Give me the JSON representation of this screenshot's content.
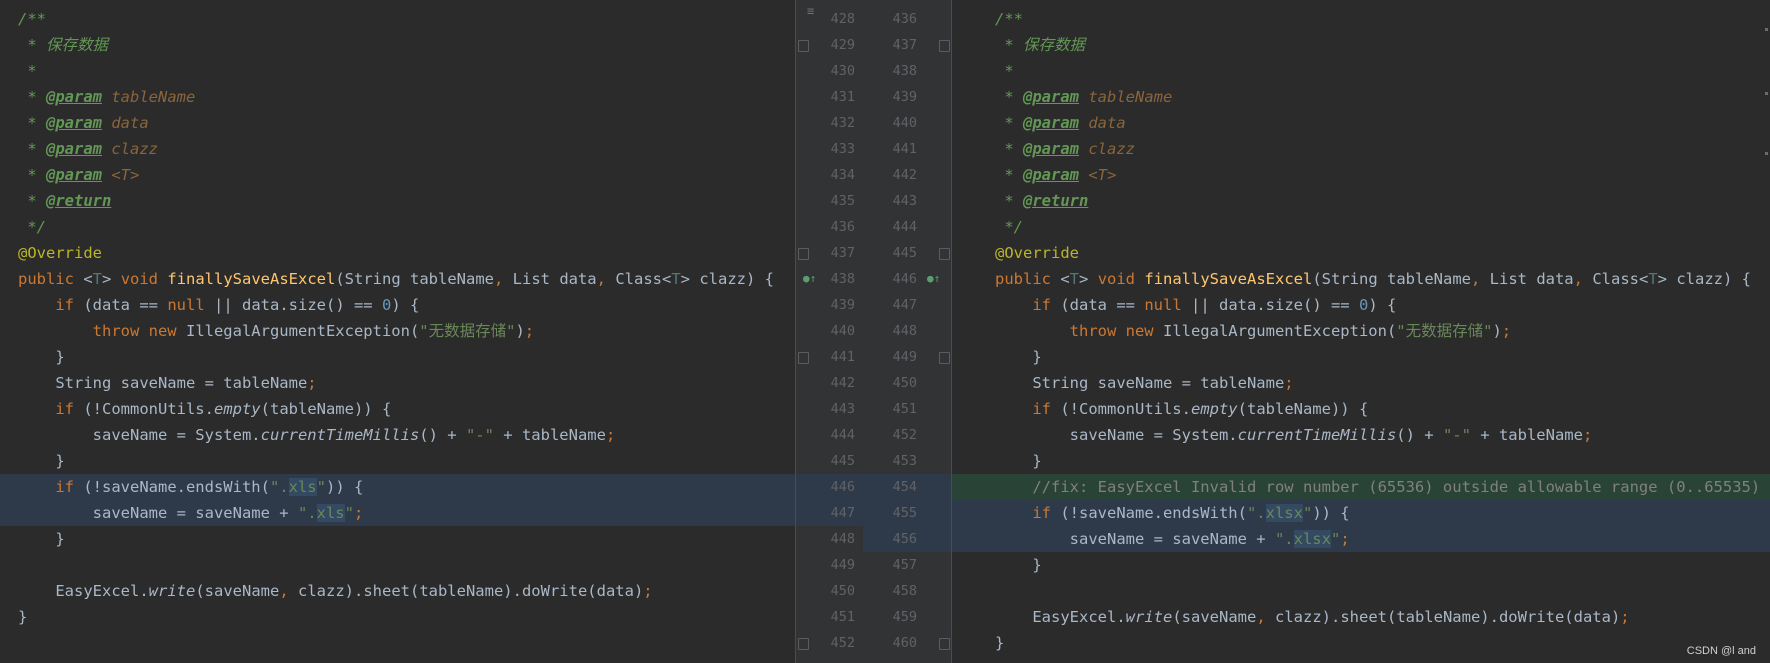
{
  "left": {
    "lines": [
      [
        [
          "c-com",
          "/**"
        ]
      ],
      [
        [
          "c-com",
          " * 保存数据"
        ]
      ],
      [
        [
          "c-com",
          " *"
        ]
      ],
      [
        [
          "c-com",
          " * "
        ],
        [
          "c-tag",
          "@param"
        ],
        [
          "c-com",
          " "
        ],
        [
          "c-pn",
          "tableName"
        ]
      ],
      [
        [
          "c-com",
          " * "
        ],
        [
          "c-tag",
          "@param"
        ],
        [
          "c-com",
          " "
        ],
        [
          "c-pn",
          "data"
        ]
      ],
      [
        [
          "c-com",
          " * "
        ],
        [
          "c-tag",
          "@param"
        ],
        [
          "c-com",
          " "
        ],
        [
          "c-pn",
          "clazz"
        ]
      ],
      [
        [
          "c-com",
          " * "
        ],
        [
          "c-tag",
          "@param"
        ],
        [
          "c-com",
          " "
        ],
        [
          "c-pn",
          "<T>"
        ]
      ],
      [
        [
          "c-com",
          " * "
        ],
        [
          "c-tag",
          "@return"
        ]
      ],
      [
        [
          "c-com",
          " */"
        ]
      ],
      [
        [
          "c-ann",
          "@Override"
        ]
      ],
      [
        [
          "c-kw",
          "public "
        ],
        [
          "",
          "<"
        ],
        [
          "c-tp",
          "T"
        ],
        [
          "",
          "> "
        ],
        [
          "c-kw",
          "void "
        ],
        [
          "c-fn",
          "finallySaveAsExcel"
        ],
        [
          "",
          "(String tableName"
        ],
        [
          "c-kw",
          ", "
        ],
        [
          "",
          "List data"
        ],
        [
          "c-kw",
          ", "
        ],
        [
          "",
          "Class<"
        ],
        [
          "c-tp",
          "T"
        ],
        [
          "",
          "> clazz) {"
        ]
      ],
      [
        [
          "",
          "    "
        ],
        [
          "c-kw",
          "if "
        ],
        [
          "",
          "(data == "
        ],
        [
          "c-kw",
          "null "
        ],
        [
          "",
          "|| data.size() == "
        ],
        [
          "c-num",
          "0"
        ],
        [
          "",
          ") {"
        ]
      ],
      [
        [
          "",
          "        "
        ],
        [
          "c-kw",
          "throw new "
        ],
        [
          "",
          "IllegalArgumentException("
        ],
        [
          "c-str",
          "\"无数据存储\""
        ],
        [
          "",
          ")"
        ],
        [
          "c-kw",
          ";"
        ]
      ],
      [
        [
          "",
          "    }"
        ]
      ],
      [
        [
          "",
          "    String saveName = tableName"
        ],
        [
          "c-kw",
          ";"
        ]
      ],
      [
        [
          "",
          "    "
        ],
        [
          "c-kw",
          "if "
        ],
        [
          "",
          "(!CommonUtils."
        ],
        [
          "c-st",
          "empty"
        ],
        [
          "",
          "(tableName)) {"
        ]
      ],
      [
        [
          "",
          "        saveName = System."
        ],
        [
          "c-st",
          "currentTimeMillis"
        ],
        [
          "",
          "() + "
        ],
        [
          "c-str",
          "\"-\""
        ],
        [
          "",
          " + tableName"
        ],
        [
          "c-kw",
          ";"
        ]
      ],
      [
        [
          "",
          "    }"
        ]
      ],
      [
        [
          "",
          "    "
        ],
        [
          "c-kw",
          "if "
        ],
        [
          "",
          "(!saveName.endsWith("
        ],
        [
          "c-str",
          "\"."
        ],
        [
          "c-str mark-box",
          "xls"
        ],
        [
          "c-str",
          "\""
        ],
        [
          "",
          ")) {"
        ]
      ],
      [
        [
          "",
          "        saveName = saveName + "
        ],
        [
          "c-str",
          "\"."
        ],
        [
          "c-str mark-box",
          "xls"
        ],
        [
          "c-str",
          "\""
        ],
        [
          "c-kw",
          ";"
        ]
      ],
      [
        [
          "",
          "    }"
        ]
      ],
      [
        [
          "",
          ""
        ]
      ],
      [
        [
          "",
          "    EasyExcel."
        ],
        [
          "c-st",
          "write"
        ],
        [
          "",
          "(saveName"
        ],
        [
          "c-kw",
          ", "
        ],
        [
          "",
          "clazz).sheet(tableName).doWrite(data)"
        ],
        [
          "c-kw",
          ";"
        ]
      ],
      [
        [
          "",
          "}"
        ]
      ]
    ]
  },
  "right": {
    "lines": [
      [
        [
          "c-com",
          "/**"
        ]
      ],
      [
        [
          "c-com",
          " * 保存数据"
        ]
      ],
      [
        [
          "c-com",
          " *"
        ]
      ],
      [
        [
          "c-com",
          " * "
        ],
        [
          "c-tag",
          "@param"
        ],
        [
          "c-com",
          " "
        ],
        [
          "c-pn",
          "tableName"
        ]
      ],
      [
        [
          "c-com",
          " * "
        ],
        [
          "c-tag",
          "@param"
        ],
        [
          "c-com",
          " "
        ],
        [
          "c-pn",
          "data"
        ]
      ],
      [
        [
          "c-com",
          " * "
        ],
        [
          "c-tag",
          "@param"
        ],
        [
          "c-com",
          " "
        ],
        [
          "c-pn",
          "clazz"
        ]
      ],
      [
        [
          "c-com",
          " * "
        ],
        [
          "c-tag",
          "@param"
        ],
        [
          "c-com",
          " "
        ],
        [
          "c-pn",
          "<T>"
        ]
      ],
      [
        [
          "c-com",
          " * "
        ],
        [
          "c-tag",
          "@return"
        ]
      ],
      [
        [
          "c-com",
          " */"
        ]
      ],
      [
        [
          "c-ann",
          "@Override"
        ]
      ],
      [
        [
          "c-kw",
          "public "
        ],
        [
          "",
          "<"
        ],
        [
          "c-tp",
          "T"
        ],
        [
          "",
          "> "
        ],
        [
          "c-kw",
          "void "
        ],
        [
          "c-fn",
          "finallySaveAsExcel"
        ],
        [
          "",
          "(String tableName"
        ],
        [
          "c-kw",
          ", "
        ],
        [
          "",
          "List data"
        ],
        [
          "c-kw",
          ", "
        ],
        [
          "",
          "Class<"
        ],
        [
          "c-tp",
          "T"
        ],
        [
          "",
          "> clazz) {"
        ]
      ],
      [
        [
          "",
          "    "
        ],
        [
          "c-kw",
          "if "
        ],
        [
          "",
          "(data == "
        ],
        [
          "c-kw",
          "null "
        ],
        [
          "",
          "|| data.size() == "
        ],
        [
          "c-num",
          "0"
        ],
        [
          "",
          ") {"
        ]
      ],
      [
        [
          "",
          "        "
        ],
        [
          "c-kw",
          "throw new "
        ],
        [
          "",
          "IllegalArgumentException("
        ],
        [
          "c-str",
          "\"无数据存储\""
        ],
        [
          "",
          ")"
        ],
        [
          "c-kw",
          ";"
        ]
      ],
      [
        [
          "",
          "    }"
        ]
      ],
      [
        [
          "",
          "    String saveName = tableName"
        ],
        [
          "c-kw",
          ";"
        ]
      ],
      [
        [
          "",
          "    "
        ],
        [
          "c-kw",
          "if "
        ],
        [
          "",
          "(!CommonUtils."
        ],
        [
          "c-st",
          "empty"
        ],
        [
          "",
          "(tableName)) {"
        ]
      ],
      [
        [
          "",
          "        saveName = System."
        ],
        [
          "c-st",
          "currentTimeMillis"
        ],
        [
          "",
          "() + "
        ],
        [
          "c-str",
          "\"-\""
        ],
        [
          "",
          " + tableName"
        ],
        [
          "c-kw",
          ";"
        ]
      ],
      [
        [
          "",
          "    }"
        ]
      ],
      [
        [
          "",
          "    "
        ],
        [
          "c-lc",
          "//fix: EasyExcel Invalid row number (65536) outside allowable range (0..65535)"
        ]
      ],
      [
        [
          "",
          "    "
        ],
        [
          "c-kw",
          "if "
        ],
        [
          "",
          "(!saveName.endsWith("
        ],
        [
          "c-str",
          "\"."
        ],
        [
          "c-str mark-box",
          "xlsx"
        ],
        [
          "c-str",
          "\""
        ],
        [
          "",
          ")) {"
        ]
      ],
      [
        [
          "",
          "        saveName = saveName + "
        ],
        [
          "c-str",
          "\"."
        ],
        [
          "c-str mark-box",
          "xlsx"
        ],
        [
          "c-str",
          "\""
        ],
        [
          "c-kw",
          ";"
        ]
      ],
      [
        [
          "",
          "    }"
        ]
      ],
      [
        [
          "",
          ""
        ]
      ],
      [
        [
          "",
          "    EasyExcel."
        ],
        [
          "c-st",
          "write"
        ],
        [
          "",
          "(saveName"
        ],
        [
          "c-kw",
          ", "
        ],
        [
          "",
          "clazz).sheet(tableName).doWrite(data)"
        ],
        [
          "c-kw",
          ";"
        ]
      ],
      [
        [
          "",
          "}"
        ]
      ]
    ]
  },
  "gutter": {
    "left_numbers": [
      "428",
      "429",
      "430",
      "431",
      "432",
      "433",
      "434",
      "435",
      "436",
      "437",
      "438",
      "439",
      "440",
      "441",
      "442",
      "443",
      "444",
      "445",
      "446",
      "447",
      "448",
      "449",
      "450",
      "451",
      "452"
    ],
    "right_numbers": [
      "436",
      "437",
      "438",
      "439",
      "440",
      "441",
      "442",
      "443",
      "444",
      "445",
      "446",
      "447",
      "448",
      "449",
      "450",
      "451",
      "452",
      "453",
      "454",
      "455",
      "456",
      "457",
      "458",
      "459",
      "460"
    ]
  },
  "watermark": "CSDN @l and"
}
